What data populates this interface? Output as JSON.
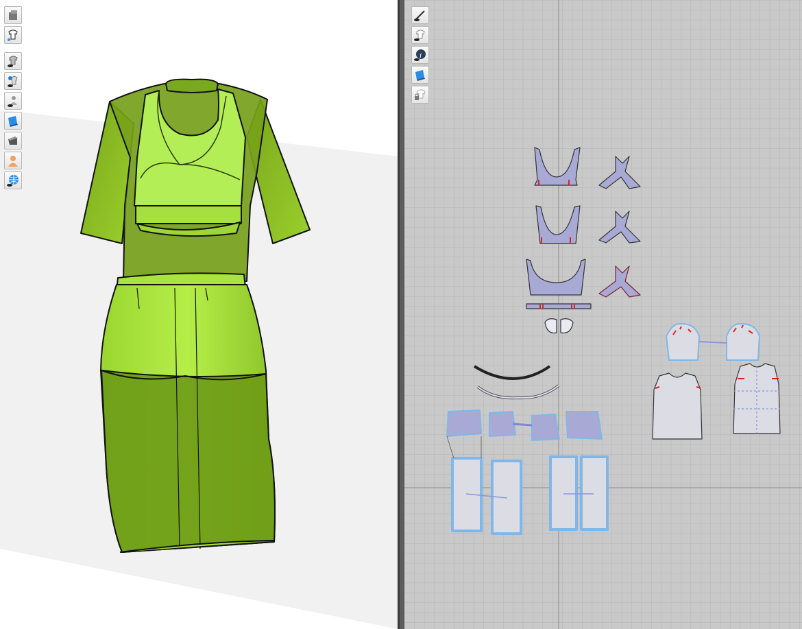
{
  "viewport_3d": {
    "toolbar": [
      {
        "name": "render-mode-icon"
      },
      {
        "name": "garment-display-icon"
      },
      {
        "name": "show-garment-icon"
      },
      {
        "name": "show-pins-icon"
      },
      {
        "name": "show-avatar-icon"
      },
      {
        "name": "fabric-thickness-icon"
      },
      {
        "name": "show-shadow-icon"
      },
      {
        "name": "avatar-skin-icon"
      },
      {
        "name": "environment-icon"
      }
    ]
  },
  "viewport_2d": {
    "toolbar": [
      {
        "name": "show-stitch-icon"
      },
      {
        "name": "show-pattern-icon"
      },
      {
        "name": "pattern-info-icon"
      },
      {
        "name": "texture-display-icon"
      },
      {
        "name": "lock-pattern-icon"
      }
    ]
  },
  "colors": {
    "garment_dark": "#6e9a18",
    "garment_light": "#a8e838",
    "pattern_fill": "#a9a9d6",
    "pattern_white": "#e2e2ea",
    "selection": "#7fb8e8",
    "grid_bg": "#c9c9c9"
  }
}
